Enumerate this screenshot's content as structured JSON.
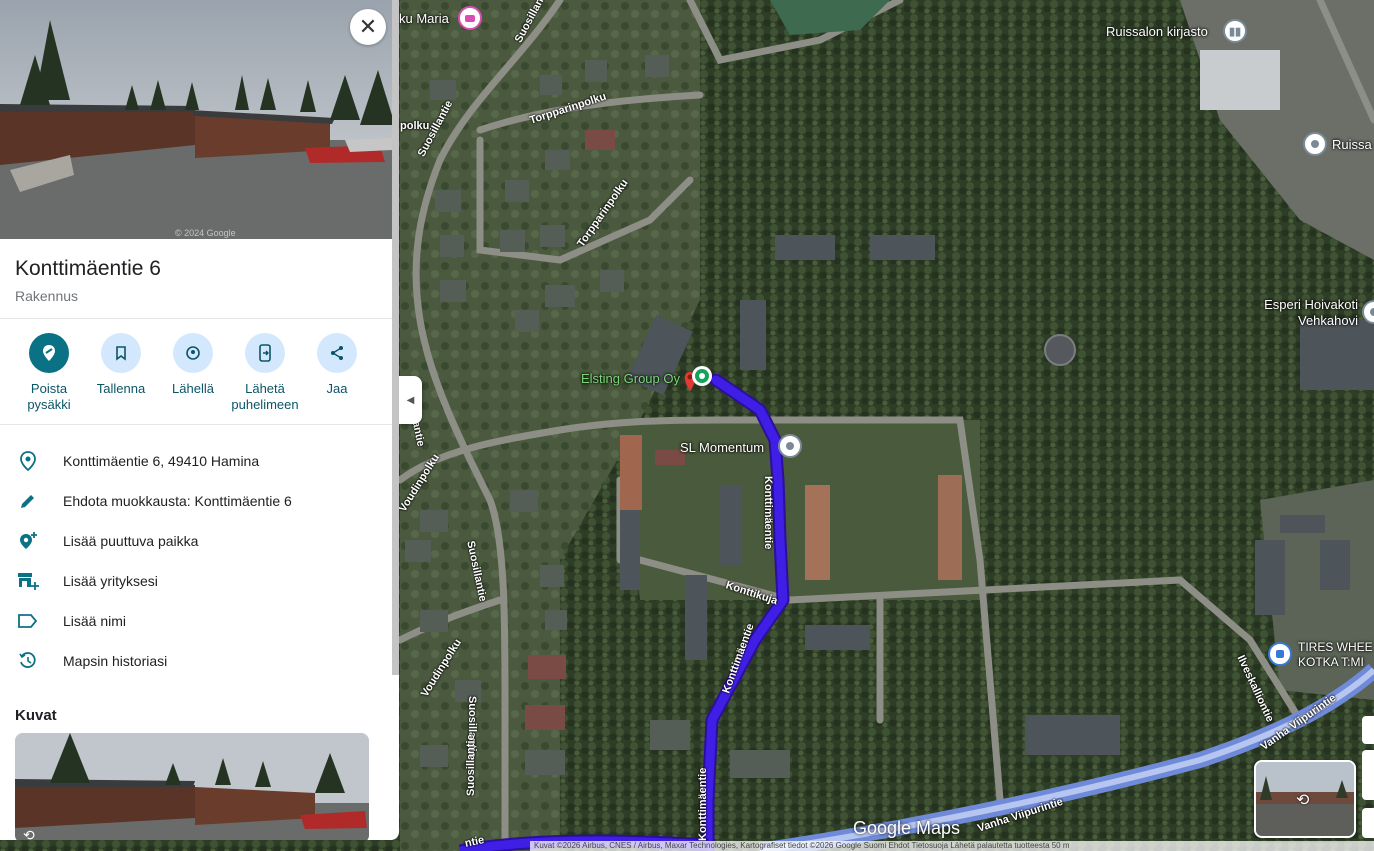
{
  "panel": {
    "title": "Konttimäentie 6",
    "type": "Rakennus",
    "actions": [
      {
        "label": "Poista\npysäkki",
        "icon": "remove-stop-icon"
      },
      {
        "label": "Tallenna",
        "icon": "bookmark-icon"
      },
      {
        "label": "Lähellä",
        "icon": "nearby-icon"
      },
      {
        "label": "Lähetä\npuhelimeen",
        "icon": "send-to-phone-icon"
      },
      {
        "label": "Jaa",
        "icon": "share-icon"
      }
    ],
    "info": [
      {
        "text": "Konttimäentie 6, 49410 Hamina",
        "icon": "location-pin-icon"
      },
      {
        "text": "Ehdota muokkausta: Konttimäentie 6",
        "icon": "pencil-icon"
      },
      {
        "text": "Lisää puuttuva paikka",
        "icon": "add-place-icon"
      },
      {
        "text": "Lisää yrityksesi",
        "icon": "add-business-icon"
      },
      {
        "text": "Lisää nimi",
        "icon": "label-icon"
      },
      {
        "text": "Mapsin historiasi",
        "icon": "history-icon"
      }
    ],
    "photos_title": "Kuvat",
    "hero_watermark": "© 2024 Google"
  },
  "map": {
    "places": {
      "ku_maria": "ku Maria",
      "ruissalon_kirjasto": "Ruissalon kirjasto",
      "ruissa": "Ruissa",
      "esperi_1": "Esperi Hoivakoti",
      "esperi_2": "Vehkahovi",
      "elsting": "Elsting Group Oy",
      "sl_momentum": "SL Momentum",
      "tires_1": "TIRES WHEE",
      "tires_2": "KOTKA T:MI"
    },
    "streets": {
      "suosillantie_1": "Suosillantie",
      "suosillantie_2": "Suosillantie",
      "suosillantie_3": "Suosillantie",
      "suosillantie_4": "Suosillantie",
      "suosillantie_5": "Suosillantie",
      "suosillantie_6": "Suosillantie",
      "torpparinpolku_1": "Torpparinpolku",
      "torpparinpolku_2": "Torpparinpolku",
      "voudinpolku_1": "Voudinpolku",
      "voudinpolku_2": "Voudinpolku",
      "konttimaentie_1": "Konttimäentie",
      "konttimaentie_2": "Konttimäentie",
      "konttimaentie_3": "Konttimäentie",
      "konttikuja": "Konttikuja",
      "vanha_viipurintie_1": "Vanha Viipurintie",
      "vanha_viipurintie_2": "Vanha Viipurintie",
      "ilveskalliontie": "Ilveskalliontie",
      "polku": "polku",
      "bottom_fragment": "ntie"
    },
    "google_logo": "Google Maps",
    "attribution": "Kuvat ©2026 Airbus, CNES / Airbus, Maxar Technologies, Kartografiset tiedot ©2026 Google   Suomi   Ehdot   Tietosuoja   Lähetä palautetta tuotteesta   50 m",
    "route_color": "#3f1ee6",
    "accent": "#0b7285"
  }
}
